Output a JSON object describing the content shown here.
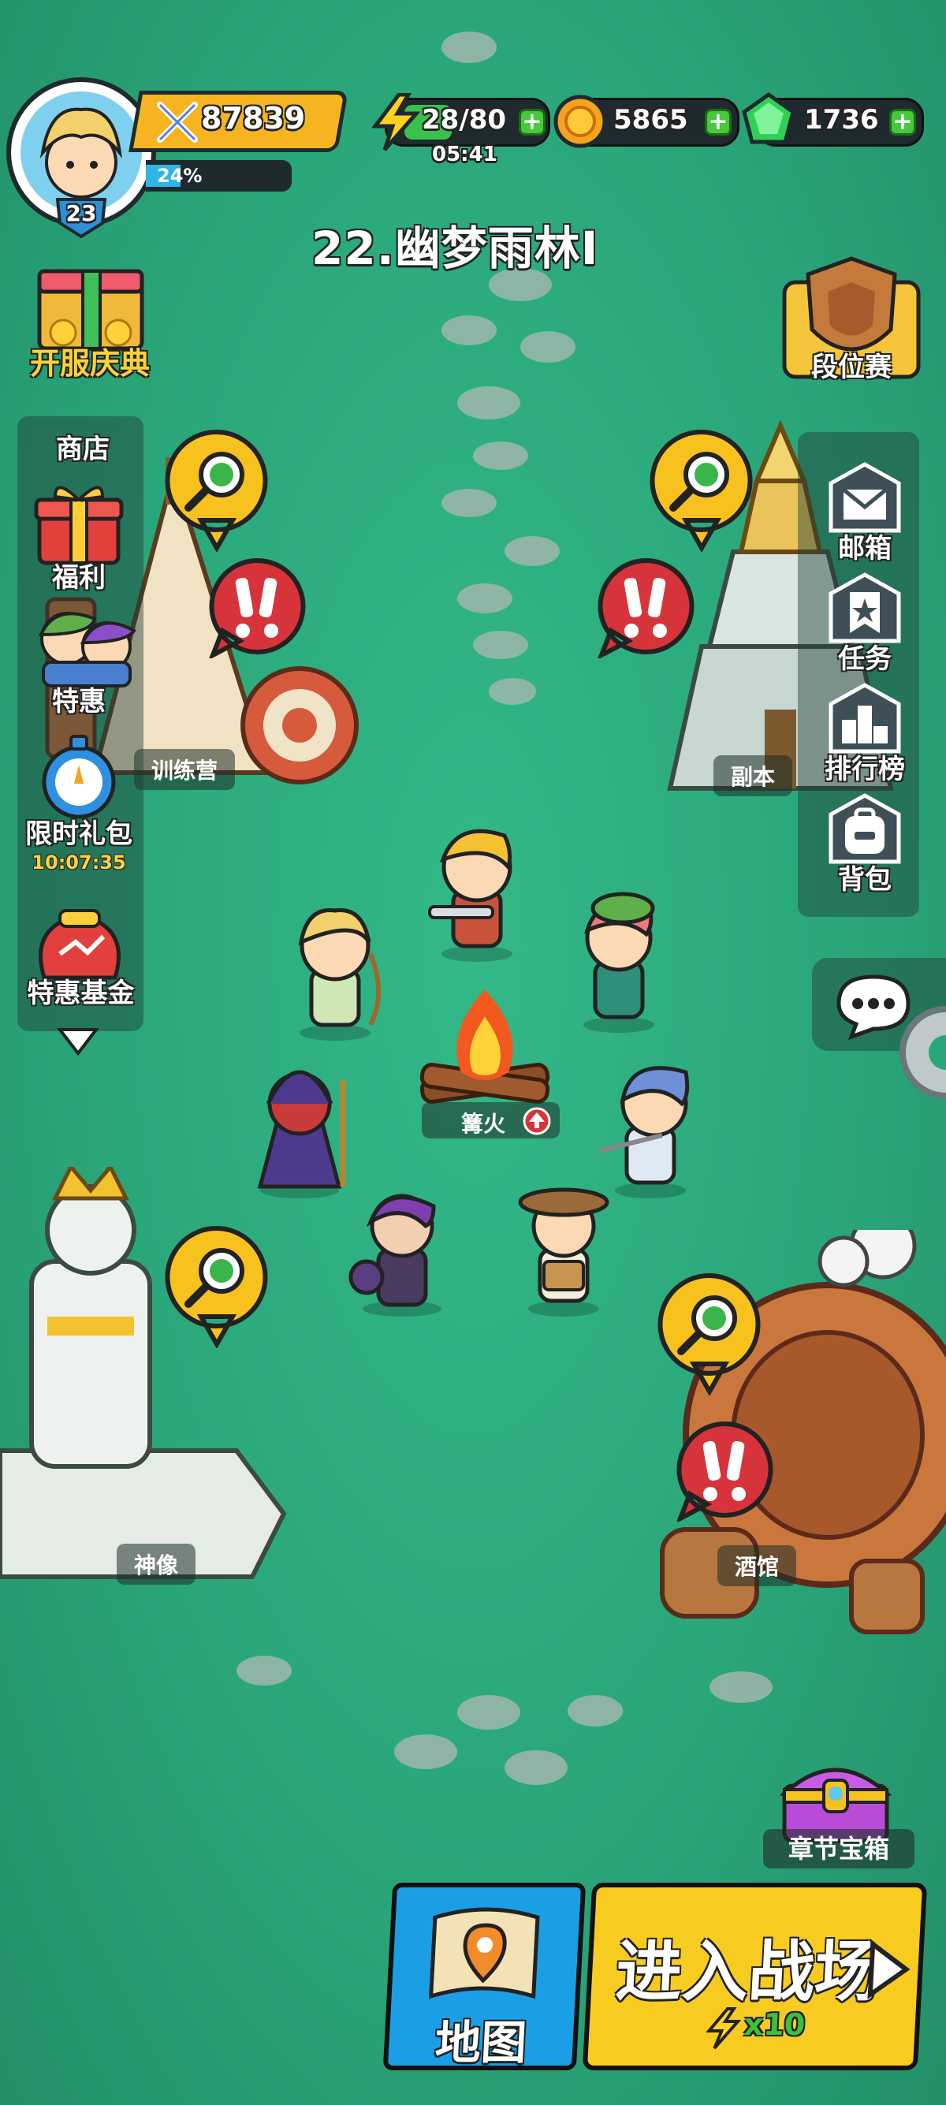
{
  "player": {
    "level": "23",
    "power": "87839",
    "exp_percent": "24%",
    "exp_fraction": 0.24
  },
  "resources": {
    "energy": "28/80",
    "energy_timer": "05:41",
    "energy_fraction": 0.35,
    "gold": "5865",
    "gems": "1736"
  },
  "stage_title": "22.幽梦雨林I",
  "left_menu": {
    "celebration": "开服庆典",
    "shop": "商店",
    "welfare": "福利",
    "special_offer": "特惠",
    "limited_pack": "限时礼包",
    "limited_pack_timer": "10:07:35",
    "special_fund": "特惠基金"
  },
  "right_menu": {
    "rank_match": "段位赛",
    "mail": "邮箱",
    "tasks": "任务",
    "leaderboard": "排行榜",
    "backpack": "背包"
  },
  "buildings": {
    "training_camp": "训练营",
    "dungeon": "副本",
    "bonfire": "篝火",
    "statue": "神像",
    "tavern": "酒馆"
  },
  "chapter_chest": "章节宝箱",
  "map_button": "地图",
  "battle_button": "进入战场",
  "battle_cost": "x10",
  "colors": {
    "grass": "#2aa77a",
    "gold": "#f7c21e",
    "blue_button": "#1aa3e8",
    "energy_green": "#39c24b"
  }
}
